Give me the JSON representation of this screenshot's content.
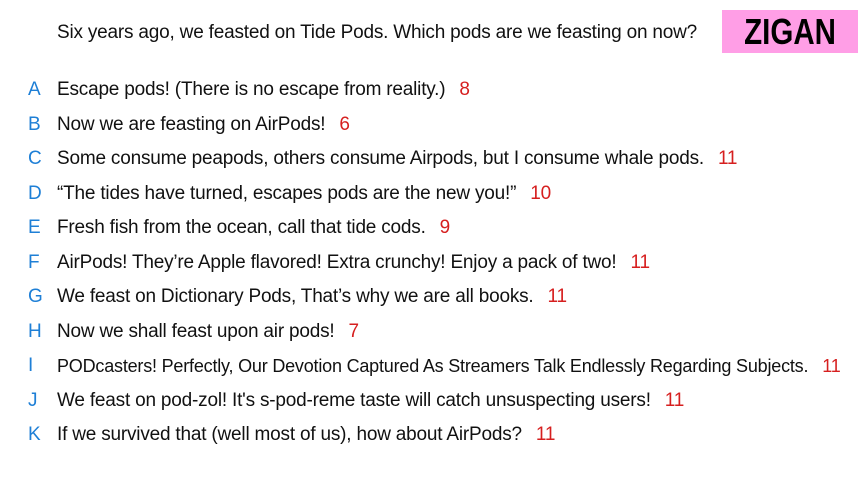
{
  "question": "Six years ago, we feasted on Tide Pods. Which pods are we feasting on now?",
  "badge": {
    "label": "ZIGAN",
    "background": "#ff9ee6"
  },
  "colors": {
    "letter": "#1e7fd6",
    "score": "#d61f1f",
    "text": "#111111"
  },
  "answers": [
    {
      "letter": "A",
      "text": "Escape pods! (There is no escape from reality.)",
      "score": "8"
    },
    {
      "letter": "B",
      "text": "Now we are feasting on AirPods!",
      "score": "6"
    },
    {
      "letter": "C",
      "text": "Some consume peapods, others consume Airpods, but I consume whale pods.",
      "score": "11"
    },
    {
      "letter": "D",
      "text": "“The tides have turned, escapes pods are the new you!”",
      "score": "10"
    },
    {
      "letter": "E",
      "text": "Fresh fish from the ocean, call that tide cods.",
      "score": "9"
    },
    {
      "letter": "F",
      "text": "AirPods! They’re Apple flavored! Extra crunchy! Enjoy a pack of two!",
      "score": "11"
    },
    {
      "letter": "G",
      "text": "We feast on Dictionary Pods, That’s why we are all books.",
      "score": "11"
    },
    {
      "letter": "H",
      "text": "Now we shall feast upon air pods!",
      "score": "7"
    },
    {
      "letter": "I",
      "text": "PODcasters! Perfectly, Our Devotion Captured As Streamers Talk Endlessly Regarding Subjects.",
      "score": "11"
    },
    {
      "letter": "J",
      "text": "We feast on pod-zol! It's s-pod-reme taste will catch unsuspecting users!",
      "score": "11"
    },
    {
      "letter": "K",
      "text": "If we survived that (well most of us), how about AirPods?",
      "score": "11"
    }
  ]
}
